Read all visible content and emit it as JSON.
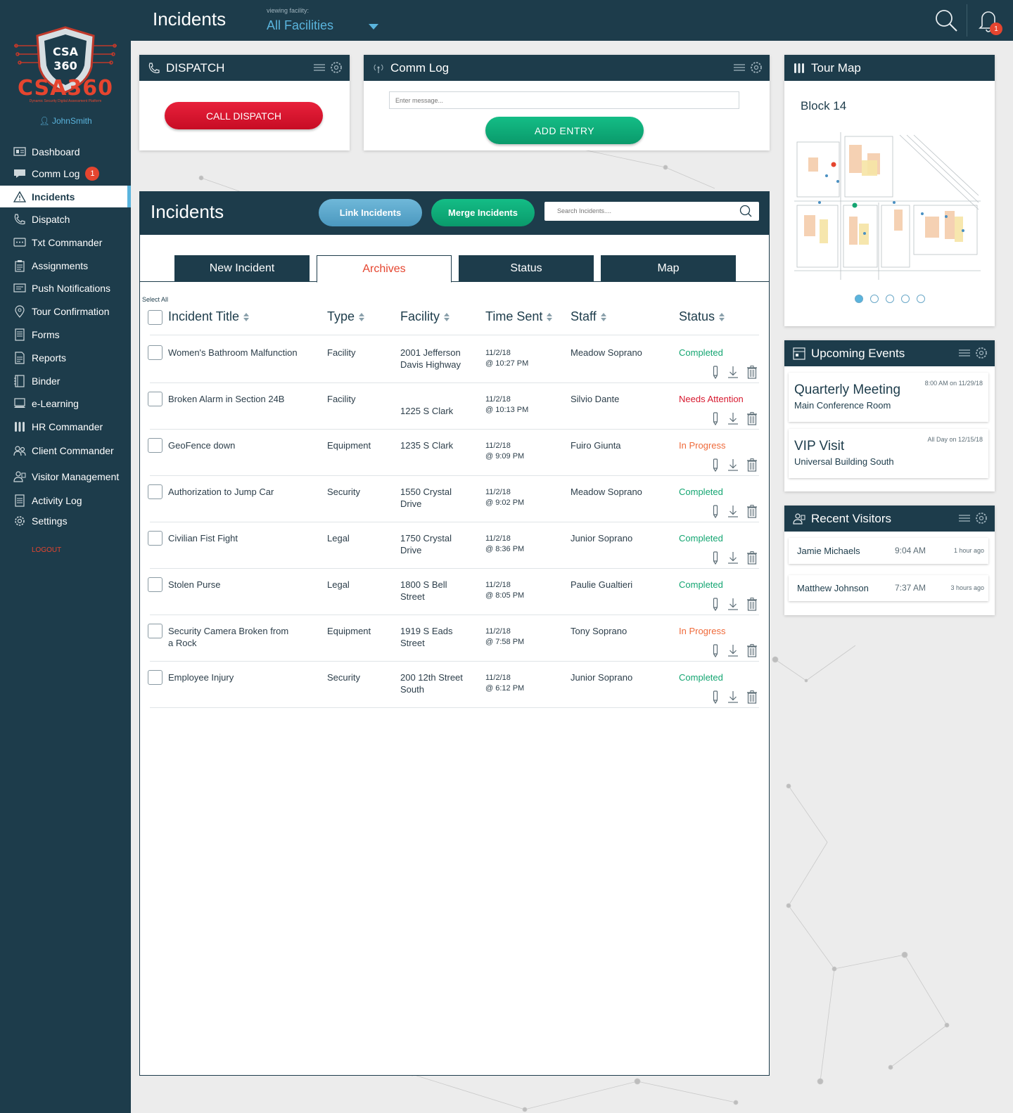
{
  "colors": {
    "navy": "#1d3c4b",
    "accent_blue": "#5ab4dd",
    "brand_red": "#e5452f",
    "call_red": "#e8213b",
    "green": "#13a571",
    "status_attention": "#d7192f",
    "status_progress": "#ef6a3a"
  },
  "brand": {
    "logo_text": "CSA360",
    "logo_seal_text": "CSA 360",
    "tagline": "Dynamic Security Digital Assessment Platform",
    "username": "JohnSmith"
  },
  "sidebar": {
    "items": [
      {
        "label": "Dashboard",
        "icon": "dashboard-icon"
      },
      {
        "label": "Comm Log",
        "icon": "chat-icon",
        "badge": "1"
      },
      {
        "label": "Incidents",
        "icon": "warning-icon",
        "active": true
      },
      {
        "label": "Dispatch",
        "icon": "phone-icon"
      },
      {
        "label": "Txt Commander",
        "icon": "message-icon"
      },
      {
        "label": "Assignments",
        "icon": "clipboard-icon"
      },
      {
        "label": "Push Notifications",
        "icon": "notification-icon"
      },
      {
        "label": "Tour Confirmation",
        "icon": "location-pin-icon"
      },
      {
        "label": "Forms",
        "icon": "form-icon"
      },
      {
        "label": "Reports",
        "icon": "report-icon"
      },
      {
        "label": "Binder",
        "icon": "binder-icon"
      },
      {
        "label": "e-Learning",
        "icon": "learning-icon"
      },
      {
        "label": "HR Commander",
        "icon": "people-icon"
      },
      {
        "label": "Client Commander",
        "icon": "client-icon"
      },
      {
        "label": "Visitor Management",
        "icon": "visitor-icon"
      },
      {
        "label": "Activity Log",
        "icon": "log-icon"
      },
      {
        "label": "Settings",
        "icon": "gear-icon"
      }
    ],
    "logout": "LOGOUT"
  },
  "header": {
    "title": "Incidents",
    "facility_label": "viewing facility:",
    "facility_value": "All Facilities",
    "notification_count": "1"
  },
  "dispatch": {
    "title": "DISPATCH",
    "call_button": "CALL DISPATCH"
  },
  "comm_log": {
    "title": "Comm Log",
    "placeholder": "Enter message...",
    "add_button": "ADD  ENTRY"
  },
  "tour_map": {
    "title": "Tour Map",
    "block": "Block 14",
    "page_count": 5,
    "active_page": 1
  },
  "upcoming_events": {
    "title": "Upcoming Events",
    "events": [
      {
        "title": "Quarterly Meeting",
        "location": "Main Conference Room",
        "when": "8:00 AM on 11/29/18"
      },
      {
        "title": "VIP Visit",
        "location": "Universal Building South",
        "when": "All Day on 12/15/18"
      }
    ]
  },
  "recent_visitors": {
    "title": "Recent Visitors",
    "visitors": [
      {
        "name": "Jamie Michaels",
        "time": "9:04 AM",
        "ago": "1 hour ago"
      },
      {
        "name": "Matthew Johnson",
        "time": "7:37 AM",
        "ago": "3 hours ago"
      }
    ]
  },
  "incidents": {
    "title": "Incidents",
    "link_button": "Link Incidents",
    "merge_button": "Merge Incidents",
    "search_placeholder": "Search Incidents....",
    "tabs": [
      "New Incident",
      "Archives",
      "Status",
      "Map"
    ],
    "active_tab": "Archives",
    "select_all": "Select All",
    "columns": [
      "Incident Title",
      "Type",
      "Facility",
      "Time Sent",
      "Staff",
      "Status"
    ],
    "rows": [
      {
        "title": "Women's Bathroom Malfunction",
        "type": "Facility",
        "facility": "2001 Jefferson\nDavis Highway",
        "date": "11/2/18",
        "time": "@ 10:27 PM",
        "staff": "Meadow Soprano",
        "status": "Completed",
        "status_kind": "completed"
      },
      {
        "title": "Broken Alarm in Section 24B",
        "type": "Facility",
        "facility": "\n1225 S Clark",
        "date": "11/2/18",
        "time": "@ 10:13 PM",
        "staff": "Silvio Dante",
        "status": "Needs Attention",
        "status_kind": "attention"
      },
      {
        "title": "GeoFence down",
        "type": "Equipment",
        "facility": "1235 S Clark",
        "date": "11/2/18",
        "time": "@ 9:09 PM",
        "staff": "Fuiro Giunta",
        "status": "In Progress",
        "status_kind": "progress"
      },
      {
        "title": "Authorization to Jump Car",
        "type": "Security",
        "facility": "1550 Crystal\nDrive",
        "date": "11/2/18",
        "time": "@ 9:02 PM",
        "staff": "Meadow Soprano",
        "status": "Completed",
        "status_kind": "completed"
      },
      {
        "title": "Civilian Fist Fight",
        "type": "Legal",
        "facility": "1750 Crystal\nDrive",
        "date": "11/2/18",
        "time": "@ 8:36 PM",
        "staff": "Junior Soprano",
        "status": "Completed",
        "status_kind": "completed"
      },
      {
        "title": "Stolen Purse",
        "type": "Legal",
        "facility": "1800 S Bell\nStreet",
        "date": "11/2/18",
        "time": "@ 8:05 PM",
        "staff": "Paulie Gualtieri",
        "status": "Completed",
        "status_kind": "completed"
      },
      {
        "title": "Security Camera Broken from\na Rock",
        "type": "Equipment",
        "facility": "1919 S Eads\nStreet",
        "date": "11/2/18",
        "time": "@ 7:58 PM",
        "staff": "Tony Soprano",
        "status": "In Progress",
        "status_kind": "progress"
      },
      {
        "title": "Employee Injury",
        "type": "Security",
        "facility": "200 12th Street\nSouth",
        "date": "11/2/18",
        "time": "@ 6:12 PM",
        "staff": "Junior Soprano",
        "status": "Completed",
        "status_kind": "completed"
      }
    ]
  }
}
